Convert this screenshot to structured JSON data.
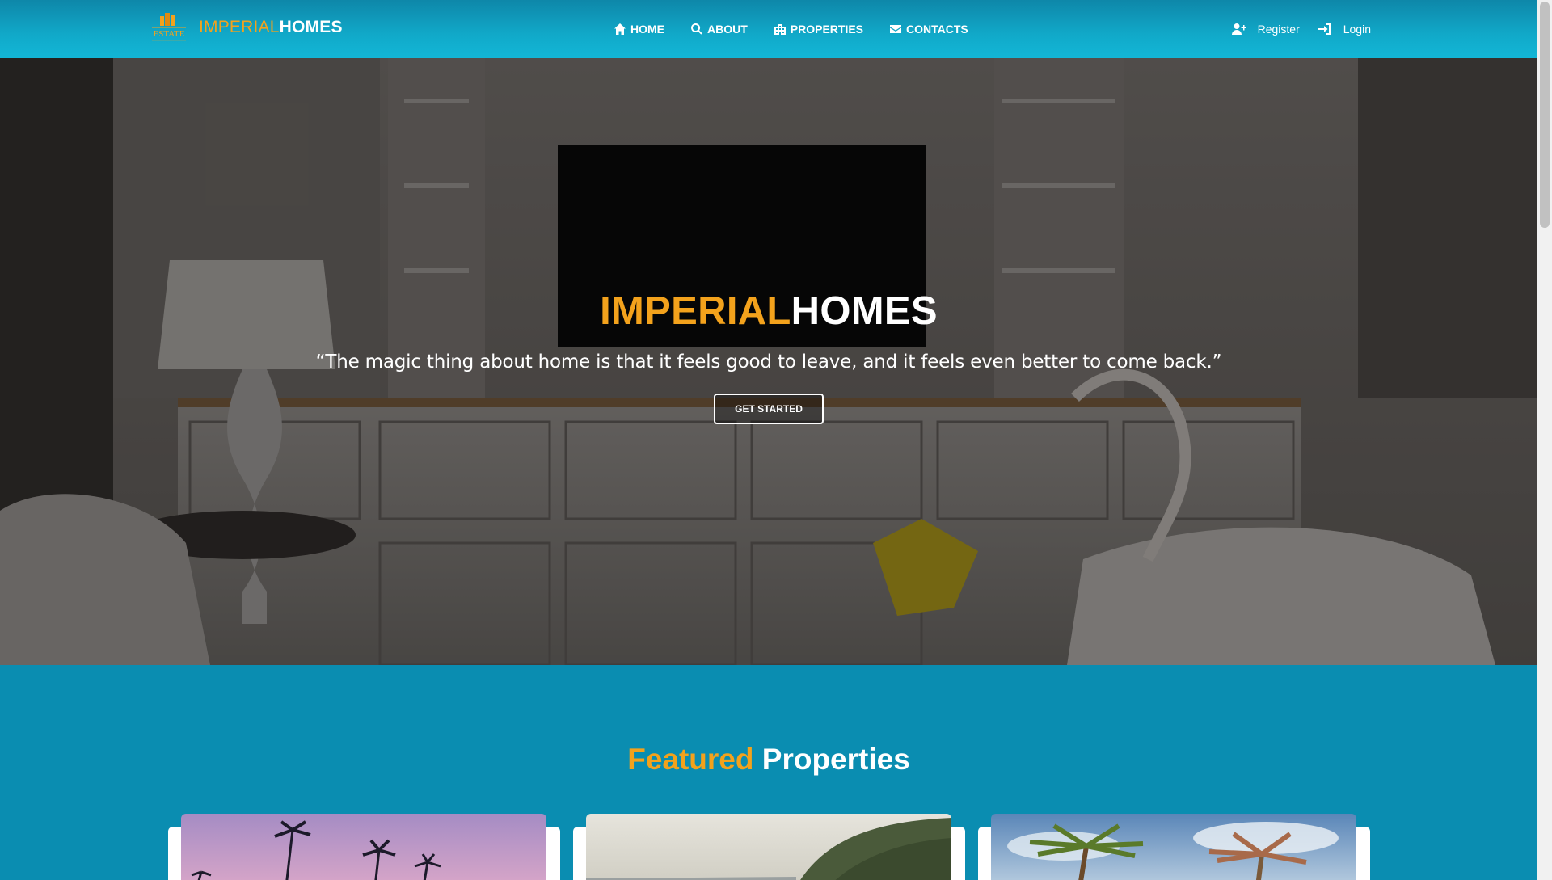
{
  "brand": {
    "logo_text": "ESTATE",
    "name_part1": "IMPERIAL",
    "name_part2": "HOMES"
  },
  "nav": {
    "items": [
      {
        "label": "HOME",
        "icon": "home-icon"
      },
      {
        "label": "ABOUT",
        "icon": "search-icon"
      },
      {
        "label": "PROPERTIES",
        "icon": "building-icon"
      },
      {
        "label": "CONTACTS",
        "icon": "envelope-icon"
      }
    ],
    "register_label": "Register",
    "register_icon": "user-plus-icon",
    "login_label": "Login",
    "login_icon": "sign-in-icon"
  },
  "hero": {
    "title_part1": "IMPERIAL",
    "title_part2": "HOMES",
    "quote": "“The magic thing about home is that it feels good to leave, and it feels even better to come back.”",
    "cta_label": "GET STARTED"
  },
  "featured": {
    "title_part1": "Featured",
    "title_part2": "Properties",
    "cards": [
      {
        "image": "palm-trees-sunset-photo"
      },
      {
        "image": "coastal-hillside-photo"
      },
      {
        "image": "palm-trees-sky-photo"
      }
    ]
  },
  "colors": {
    "accent": "#f3a21c",
    "nav_bg": "#12b6d6",
    "section_bg": "#0a8db1"
  }
}
